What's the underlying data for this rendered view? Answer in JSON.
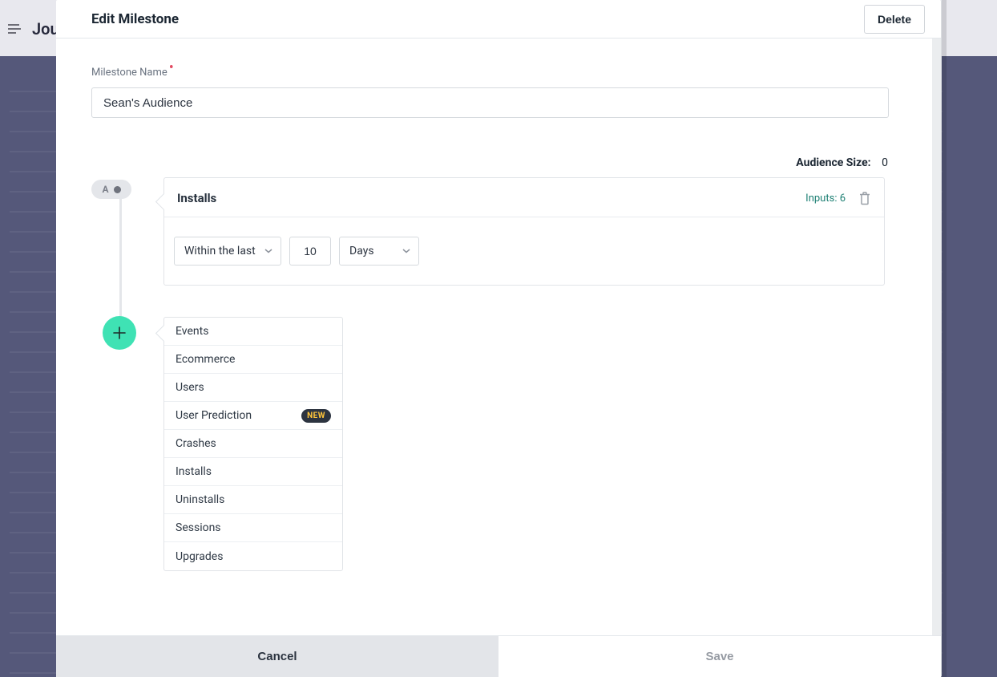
{
  "background": {
    "page_title_fragment": "Jou"
  },
  "modal": {
    "title": "Edit Milestone",
    "delete_label": "Delete",
    "milestone_label": "Milestone Name",
    "milestone_value": "Sean's Audience",
    "audience_size_label": "Audience Size:",
    "audience_size_value": "0",
    "criteria": {
      "node_letter": "A",
      "title": "Installs",
      "inputs_label": "Inputs: 6",
      "timeframe_select": "Within the last",
      "timeframe_value": "10",
      "timeframe_unit": "Days"
    },
    "add_menu": {
      "items": [
        {
          "label": "Events",
          "badge": ""
        },
        {
          "label": "Ecommerce",
          "badge": ""
        },
        {
          "label": "Users",
          "badge": ""
        },
        {
          "label": "User Prediction",
          "badge": "NEW"
        },
        {
          "label": "Crashes",
          "badge": ""
        },
        {
          "label": "Installs",
          "badge": ""
        },
        {
          "label": "Uninstalls",
          "badge": ""
        },
        {
          "label": "Sessions",
          "badge": ""
        },
        {
          "label": "Upgrades",
          "badge": ""
        }
      ]
    },
    "footer": {
      "cancel": "Cancel",
      "save": "Save"
    }
  }
}
